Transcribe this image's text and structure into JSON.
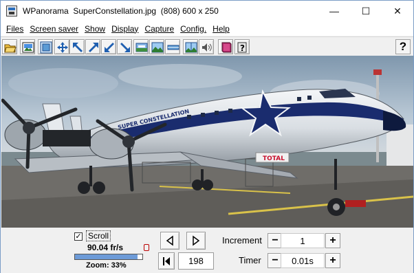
{
  "window": {
    "title": "WPanorama  SuperConstellation.jpg  (808) 600 x 250",
    "minimize_glyph": "—",
    "maximize_glyph": "☐",
    "close_glyph": "✕"
  },
  "menu": [
    {
      "label": "Files"
    },
    {
      "label": "Screen saver"
    },
    {
      "label": "Show"
    },
    {
      "label": "Display"
    },
    {
      "label": "Capture"
    },
    {
      "label": "Config."
    },
    {
      "label": "Help"
    }
  ],
  "toolbar": {
    "icons": [
      "open-folder-icon",
      "picture-icon",
      "fit-window-icon",
      "move-arrows-icon",
      "arrow-up-left-icon",
      "arrow-up-right-icon",
      "arrow-down-left-icon",
      "arrow-down-right-icon",
      "panorama-view-icon",
      "landscape-icon",
      "flat-strip-icon",
      "center-split-icon",
      "speaker-icon",
      "book-icon",
      "help-book-icon"
    ],
    "help_label": "?"
  },
  "photo": {
    "plane_text": "SUPER CONSTELLATION",
    "tail_text": "TOTAL"
  },
  "controls": {
    "scroll_checked": true,
    "scroll_check_glyph": "✓",
    "scroll_label": "Scroll",
    "fps": "90.04 fr/s",
    "zoom_label": "Zoom: 33%",
    "zoom_fraction": 0.33,
    "frame_value": "198",
    "increment_label": "Increment",
    "increment_value": "1",
    "timer_label": "Timer",
    "timer_value": "0.01s",
    "minus": "−",
    "plus": "+"
  }
}
